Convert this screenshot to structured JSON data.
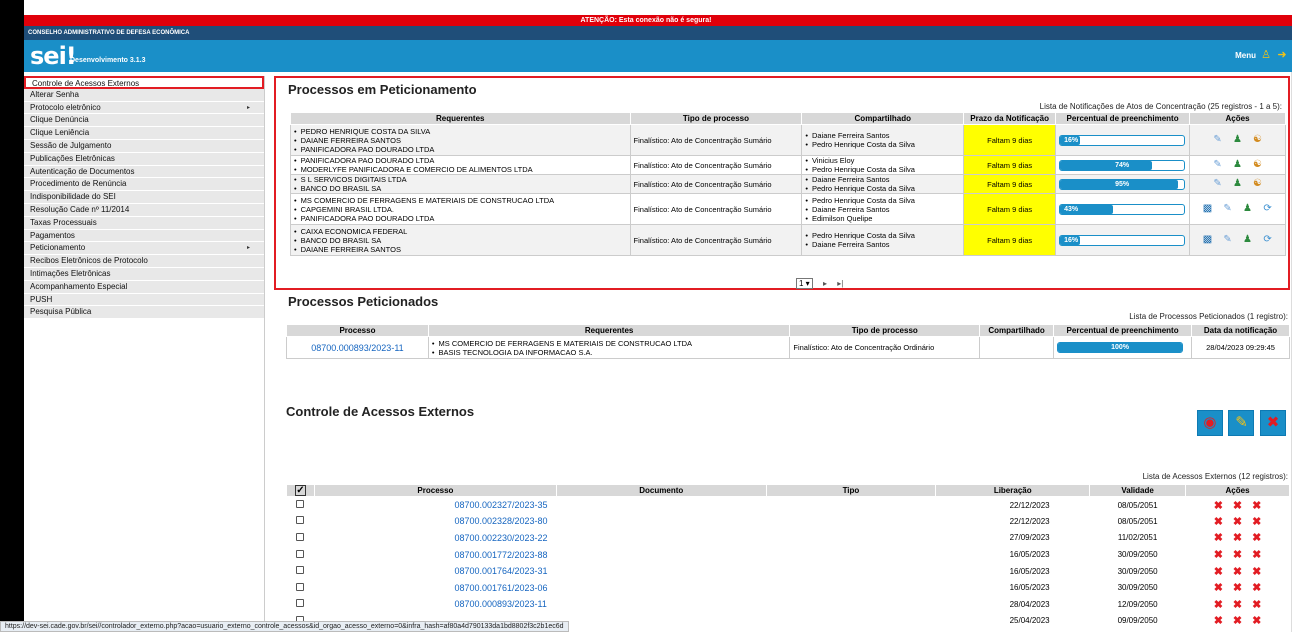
{
  "alert": "ATENÇÃO: Esta conexão não é segura!",
  "org_name": "CONSELHO ADMINISTRATIVO DE DEFESA ECONÔMICA",
  "brand": {
    "logo": "sei!",
    "env": "Desenvolvimento 3.1.3"
  },
  "header": {
    "menu": "Menu",
    "user_icon": "user-icon",
    "exit_icon": "exit-icon"
  },
  "sidebar": {
    "items": [
      {
        "label": "Controle de Acessos Externos"
      },
      {
        "label": "Alterar Senha"
      },
      {
        "label": "Protocolo eletrônico",
        "arrow": "▸"
      },
      {
        "label": "Clique Denúncia"
      },
      {
        "label": "Clique Leniência"
      },
      {
        "label": "Sessão de Julgamento"
      },
      {
        "label": "Publicações Eletrônicas"
      },
      {
        "label": "Autenticação de Documentos"
      },
      {
        "label": "Procedimento de Renúncia"
      },
      {
        "label": "Indisponibilidade do SEI"
      },
      {
        "label": "Resolução Cade nº 11/2014"
      },
      {
        "label": "Taxas Processuais"
      },
      {
        "label": "Pagamentos"
      },
      {
        "label": "Peticionamento",
        "arrow": "▸"
      },
      {
        "label": "Recibos Eletrônicos de Protocolo"
      },
      {
        "label": "Intimações Eletrônicas"
      },
      {
        "label": "Acompanhamento Especial"
      },
      {
        "label": "PUSH"
      },
      {
        "label": "Pesquisa Pública"
      }
    ]
  },
  "peticionamento": {
    "title": "Processos em Peticionamento",
    "caption": "Lista de Notificações de Atos de Concentração (25 registros - 1 a 5):",
    "headers": [
      "Requerentes",
      "Tipo de processo",
      "Compartilhado",
      "Prazo da Notificação",
      "Percentual de preenchimento",
      "Ações"
    ],
    "rows": [
      {
        "req1": "PEDRO HENRIQUE COSTA DA SILVA",
        "req2": "DAIANE FERREIRA SANTOS",
        "req3": "PANIFICADORA PAO DOURADO LTDA",
        "tipo": "Finalístico: Ato de Concentração Sumário",
        "sh1": "Daiane Ferreira Santos",
        "sh2": "Pedro Henrique Costa da Silva",
        "sh3": "",
        "prazo": "Faltam 9 dias",
        "pct": 16,
        "pct_label": "16%"
      },
      {
        "req1": "PANIFICADORA PAO DOURADO LTDA",
        "req2": "MODERLYFE PANIFICADORA E COMERCIO DE ALIMENTOS LTDA",
        "req3": "",
        "tipo": "Finalístico: Ato de Concentração Sumário",
        "sh1": "Vinicius Eloy",
        "sh2": "Pedro Henrique Costa da Silva",
        "sh3": "",
        "prazo": "Faltam 9 dias",
        "pct": 74,
        "pct_label": "74%"
      },
      {
        "req1": "S L SERVICOS DIGITAIS LTDA",
        "req2": "BANCO DO BRASIL SA",
        "req3": "",
        "tipo": "Finalístico: Ato de Concentração Sumário",
        "sh1": "Daiane Ferreira Santos",
        "sh2": "Pedro Henrique Costa da Silva",
        "sh3": "",
        "prazo": "Faltam 9 dias",
        "pct": 95,
        "pct_label": "95%"
      },
      {
        "req1": "MS COMERCIO DE FERRAGENS E MATERIAIS DE CONSTRUCAO LTDA",
        "req2": "CAPGEMINI BRASIL LTDA.",
        "req3": "PANIFICADORA PAO DOURADO LTDA",
        "tipo": "Finalístico: Ato de Concentração Sumário",
        "sh1": "Pedro Henrique Costa da Silva",
        "sh2": "Daiane Ferreira Santos",
        "sh3": "Edimilson Quelipe",
        "prazo": "Faltam 9 dias",
        "pct": 43,
        "pct_label": "43%"
      },
      {
        "req1": "CAIXA ECONOMICA FEDERAL",
        "req2": "BANCO DO BRASIL SA",
        "req3": "DAIANE FERREIRA SANTOS",
        "tipo": "Finalístico: Ato de Concentração Sumário",
        "sh1": "Pedro Henrique Costa da Silva",
        "sh2": "Daiane Ferreira Santos",
        "sh3": "",
        "prazo": "Faltam 9 dias",
        "pct": 16,
        "pct_label": "16%"
      }
    ],
    "pager": {
      "page": "1",
      "next": "▸",
      "last": "▸|"
    }
  },
  "peticionados": {
    "title": "Processos Peticionados",
    "caption": "Lista de Processos Peticionados (1 registro):",
    "headers": [
      "Processo",
      "Requerentes",
      "Tipo de processo",
      "Compartilhado",
      "Percentual de preenchimento",
      "Data da notificação"
    ],
    "row": {
      "processo": "08700.000893/2023-11",
      "req1": "MS COMERCIO DE FERRAGENS E MATERIAIS DE CONSTRUCAO LTDA",
      "req2": "BASIS TECNOLOGIA DA INFORMACAO S.A.",
      "tipo": "Finalístico: Ato de Concentração Ordinário",
      "compartilhado": "",
      "pct": 100,
      "pct_label": "100%",
      "data": "28/04/2023 09:29:45"
    }
  },
  "acessos": {
    "title": "Controle de Acessos Externos",
    "caption": "Lista de Acessos Externos (12 registros):",
    "headers": [
      "Processo",
      "Documento",
      "Tipo",
      "Liberação",
      "Validade",
      "Ações"
    ],
    "rows": [
      {
        "processo": "08700.002327/2023-35",
        "liberacao": "22/12/2023",
        "validade": "08/05/2051"
      },
      {
        "processo": "08700.002328/2023-80",
        "liberacao": "22/12/2023",
        "validade": "08/05/2051"
      },
      {
        "processo": "08700.002230/2023-22",
        "liberacao": "27/09/2023",
        "validade": "11/02/2051"
      },
      {
        "processo": "08700.001772/2023-88",
        "liberacao": "16/05/2023",
        "validade": "30/09/2050"
      },
      {
        "processo": "08700.001764/2023-31",
        "liberacao": "16/05/2023",
        "validade": "30/09/2050"
      },
      {
        "processo": "08700.001761/2023-06",
        "liberacao": "16/05/2023",
        "validade": "30/09/2050"
      },
      {
        "processo": "08700.000893/2023-11",
        "liberacao": "28/04/2023",
        "validade": "12/09/2050"
      },
      {
        "processo": "",
        "liberacao": "25/04/2023",
        "validade": "09/09/2050"
      }
    ],
    "x_glyph": "✖"
  },
  "status_url": "https://dev-sei.cade.gov.br/sei//controlador_externo.php?acao=usuario_externo_controle_acessos&id_orgao_acesso_externo=0&infra_hash=af80a4d790133da1bd8802f3c2b1ec6d",
  "colors": {
    "alert": "#e0000a",
    "header": "#1a8fc8",
    "org": "#1f4e79",
    "highlight": "#e21c23",
    "prazo": "#ffff00"
  }
}
